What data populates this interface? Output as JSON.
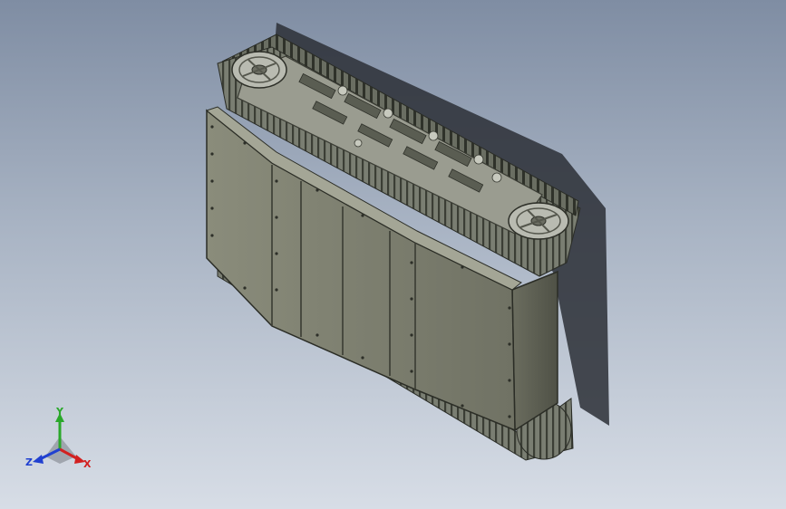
{
  "viewport": {
    "background_top": "#7f8da3",
    "background_bottom": "#d7dde6",
    "model": "tracked-chassis"
  },
  "triad": {
    "x_label": "X",
    "y_label": "Y",
    "z_label": "Z",
    "x_color": "#d22020",
    "y_color": "#2aa82a",
    "z_color": "#2040d0"
  },
  "colors": {
    "panel": "#7b7d6d",
    "panel_dark": "#555749",
    "track": "#6e7266",
    "track_dark": "#3f4238",
    "shadow": "#2b2f36"
  }
}
